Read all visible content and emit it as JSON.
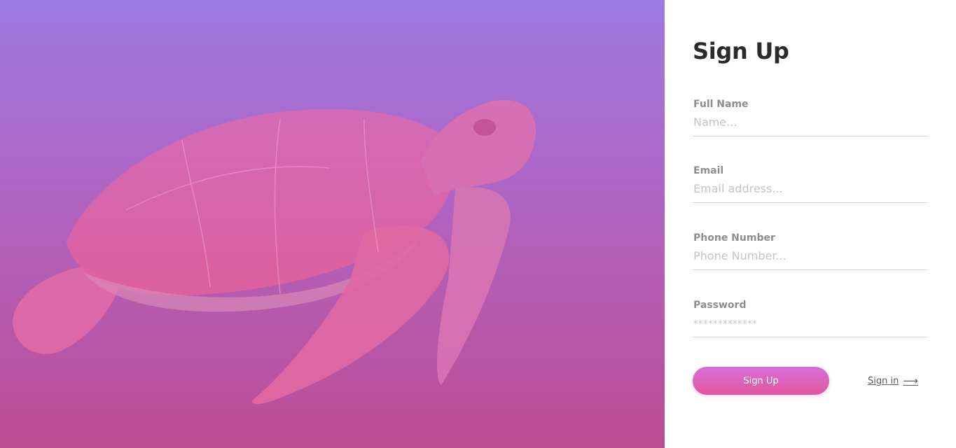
{
  "hero": {
    "image_subject": "sea turtle swimming",
    "overlay_colors": [
      "#9d79e2",
      "#bd4c93"
    ]
  },
  "form": {
    "title": "Sign Up",
    "fields": {
      "full_name": {
        "label": "Full Name",
        "placeholder": "Name..."
      },
      "email": {
        "label": "Email",
        "placeholder": "Email address..."
      },
      "phone": {
        "label": "Phone Number",
        "placeholder": "Phone Number..."
      },
      "password": {
        "label": "Password",
        "placeholder": "*************"
      }
    },
    "submit_label": "Sign Up",
    "signin_label": "Sign in",
    "signin_icon": "arrow-right-icon"
  },
  "colors": {
    "button_gradient": [
      "#d56fd8",
      "#e3559f"
    ],
    "title": "#2b2b2b",
    "label": "#8d8d8d"
  }
}
